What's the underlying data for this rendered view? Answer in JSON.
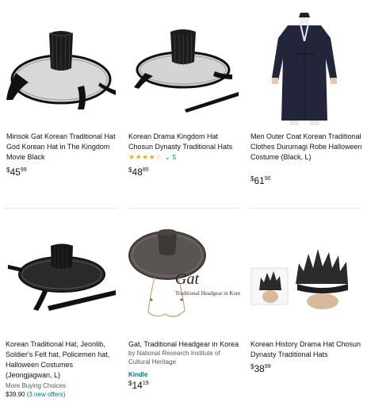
{
  "products": [
    {
      "title": "Minsok Gat Korean Traditional Hat God Korean Hat in The Kingdom Movie Black",
      "price_symbol": "$",
      "price_whole": "45",
      "price_fraction": "99"
    },
    {
      "title": "Korean Drama Kingdom Hat Chosun Dynasty Traditional Hats",
      "stars": "★★★★☆",
      "rating_count": "5",
      "price_symbol": "$",
      "price_whole": "48",
      "price_fraction": "85"
    },
    {
      "title": "Men Outer Coat Korean Traditional Clothes Durumagi Robe Halloween Costume (Black, L)",
      "price_symbol": "$",
      "price_whole": "61",
      "price_fraction": "90"
    },
    {
      "title": "Korean Traditional Hat, Jeonlib, Soldier's Felt hat, Policemen hat, Halloween Costumes (Jeongjagwan, L)",
      "more_buying_label": "More Buying Choices",
      "more_buying_price": "$39.90",
      "more_buying_offers": "(3 new offers)"
    },
    {
      "title": "Gat, Traditional Headgear in Korea",
      "byline": "by National Research Institute of Cultural Heritage",
      "format": "Kindle",
      "price_symbol": "$",
      "price_whole": "14",
      "price_fraction": "19",
      "image_caption_main": "Gat",
      "image_caption_sub": "Traditional Headgear in Korea"
    },
    {
      "title": "Korean History Drama Hat Chosun Dynasty Traditional Hats",
      "price_symbol": "$",
      "price_whole": "38",
      "price_fraction": "99"
    }
  ]
}
